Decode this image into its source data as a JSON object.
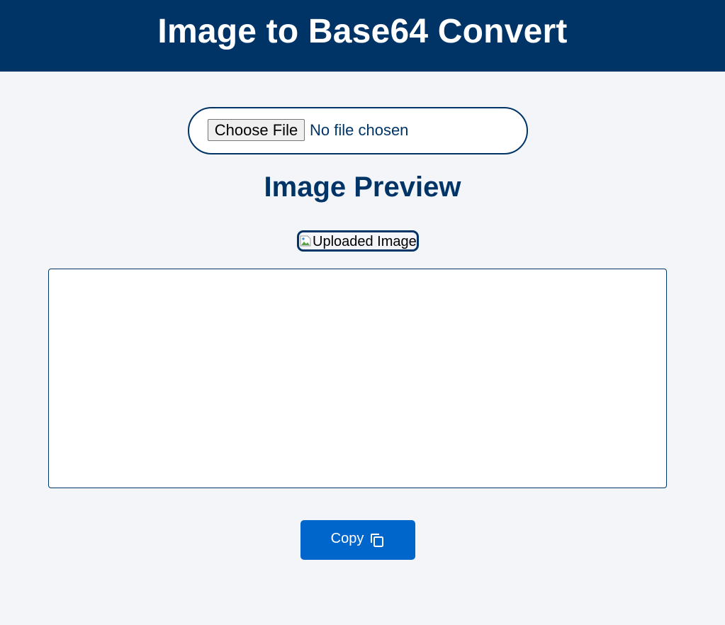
{
  "header": {
    "title": "Image to Base64 Convert"
  },
  "file_input": {
    "button_label": "Choose File",
    "status_text": "No file chosen"
  },
  "preview": {
    "title": "Image Preview",
    "image_alt": "Uploaded Image"
  },
  "output": {
    "value": ""
  },
  "copy_button": {
    "label": "Copy",
    "icon": "copy-icon"
  },
  "colors": {
    "header_bg": "#003466",
    "page_bg": "#f3f5f9",
    "accent": "#0066cc",
    "text_primary": "#003466"
  }
}
